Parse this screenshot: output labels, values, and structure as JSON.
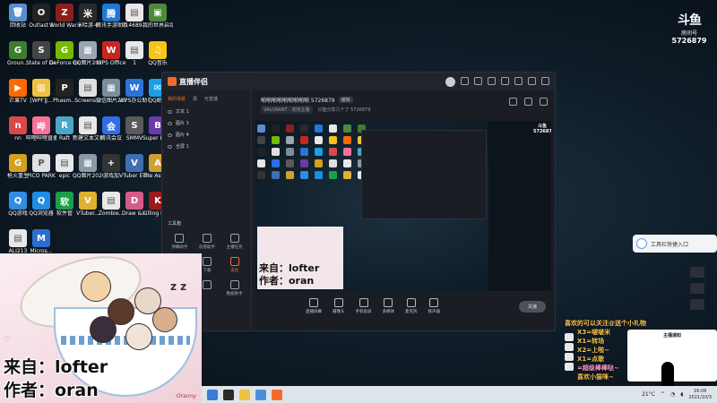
{
  "desktop": {
    "icons": [
      {
        "label": "回收站",
        "color": "#5b8ccf",
        "glyph": "🗑"
      },
      {
        "label": "Outlast 2",
        "color": "#222222",
        "glyph": "O"
      },
      {
        "label": "World War Z",
        "color": "#8b1e1e",
        "glyph": "Z"
      },
      {
        "label": "米哈游-6",
        "color": "#2a2a2a",
        "glyph": "米"
      },
      {
        "label": "腾讯手游助手",
        "color": "#1f7ad6",
        "glyph": "腾"
      },
      {
        "label": "914689...",
        "color": "#e8e8e8",
        "glyph": "▤"
      },
      {
        "label": "我的世界启动器",
        "color": "#4c8a3a",
        "glyph": "▣"
      },
      {
        "label": "Groun...",
        "color": "#3d7d2e",
        "glyph": "G"
      },
      {
        "label": "State of Decay 2",
        "color": "#444444",
        "glyph": "S"
      },
      {
        "label": "GeForce Experie...",
        "color": "#76b900",
        "glyph": "G"
      },
      {
        "label": "QQ图片202106...",
        "color": "#9aa7b3",
        "glyph": "▦"
      },
      {
        "label": "WPS Office",
        "color": "#c8261f",
        "glyph": "W"
      },
      {
        "label": "1",
        "color": "#e8e8e8",
        "glyph": "▤"
      },
      {
        "label": "QQ音乐",
        "color": "#f5c518",
        "glyph": "♫"
      },
      {
        "label": "芒果TV",
        "color": "#ff6a00",
        "glyph": "▶"
      },
      {
        "label": "[WPF]J...",
        "color": "#f0c140",
        "glyph": "▥"
      },
      {
        "label": "Phasm...",
        "color": "#222222",
        "glyph": "P"
      },
      {
        "label": "Screens...",
        "color": "#e0e0e0",
        "glyph": "▤"
      },
      {
        "label": "微信图片202106...",
        "color": "#7b8e9c",
        "glyph": "▦"
      },
      {
        "label": "WPS办公助手",
        "color": "#2b73d6",
        "glyph": "W"
      },
      {
        "label": "QQ邮箱",
        "color": "#1aa0e8",
        "glyph": "✉"
      },
      {
        "label": "nn",
        "color": "#d84a4a",
        "glyph": "n"
      },
      {
        "label": "哔哩哔哩直播姬",
        "color": "#fb7299",
        "glyph": "哔"
      },
      {
        "label": "Raft",
        "color": "#4aa7c8",
        "glyph": "R"
      },
      {
        "label": "新建文本文档",
        "color": "#e8e8e8",
        "glyph": "▤"
      },
      {
        "label": "腾讯会议",
        "color": "#2f6ee6",
        "glyph": "会"
      },
      {
        "label": "SMMV",
        "color": "#5a5a5a",
        "glyph": "S"
      },
      {
        "label": "Super Bun...",
        "color": "#6a3ba8",
        "glyph": "B"
      },
      {
        "label": "枪火重生",
        "color": "#d3a11e",
        "glyph": "G"
      },
      {
        "label": "PICO PARK",
        "color": "#e0e0e0",
        "glyph": "P"
      },
      {
        "label": "epic",
        "color": "#e8e8e8",
        "glyph": "▤"
      },
      {
        "label": "QQ图片202007...",
        "color": "#8a9aa8",
        "glyph": "▦"
      },
      {
        "label": "游戏加",
        "color": "#333333",
        "glyph": "+"
      },
      {
        "label": "VTuber Editor",
        "color": "#3f6fb0",
        "glyph": "V"
      },
      {
        "label": "The Ascent",
        "color": "#cfa030",
        "glyph": "A"
      },
      {
        "label": "QQ游戏",
        "color": "#2f8de4",
        "glyph": "Q"
      },
      {
        "label": "QQ浏览器",
        "color": "#1f8ce6",
        "glyph": "Q"
      },
      {
        "label": "软件管",
        "color": "#1aa04a",
        "glyph": "软"
      },
      {
        "label": "VTuber...",
        "color": "#e0b030",
        "glyph": "V"
      },
      {
        "label": "Zombie...",
        "color": "#e8e8e8",
        "glyph": "▤"
      },
      {
        "label": "Draw &...",
        "color": "#d55a8a",
        "glyph": "D"
      },
      {
        "label": "Killing Floor 2",
        "color": "#9b1a1a",
        "glyph": "K"
      },
      {
        "label": "ALI213",
        "color": "#e8e8e8",
        "glyph": "▤"
      },
      {
        "label": "Micros...",
        "color": "#2a6fd0",
        "glyph": "M"
      }
    ]
  },
  "overlay_logo": {
    "mark": "斗鱼",
    "room_label": "房间号",
    "room_number": "5726879"
  },
  "stream_app": {
    "title": "直播伴侣",
    "left_tabs": [
      "我的场景",
      "源",
      "可直播"
    ],
    "scenes": [
      "文本 1",
      "图片 3",
      "图片 4",
      "全屏 1"
    ],
    "tools_label": "工具箱",
    "tools": [
      {
        "label": "弹幕助手",
        "hl": false
      },
      {
        "label": "房管助手",
        "hl": false
      },
      {
        "label": "主播任务",
        "hl": false
      },
      {
        "label": "房间管理",
        "hl": false
      },
      {
        "label": "下载",
        "hl": false
      },
      {
        "label": "道具",
        "hl": true
      },
      {
        "label": "高清推流",
        "hl": false
      },
      {
        "label": "",
        "hl": false
      },
      {
        "label": "数据助手",
        "hl": false
      }
    ],
    "room_title": "啪啪啪啪啪啪啪啪啪 5726879",
    "edit_label": "编辑",
    "category": "VALORANT - 欢快主播",
    "room_meta": "只能分享几个了 5726879",
    "controls": [
      "直播屏幕",
      "摄像头",
      "手机投屏",
      "多媒体",
      "麦克风",
      "扬声器"
    ],
    "go_live": "关播"
  },
  "fanart": {
    "source_line": "来自：lofter",
    "author_line": "作者：oran",
    "signature": "Oranny"
  },
  "side_widget": {
    "label": "工具栏快捷入口"
  },
  "chat": {
    "title": "喜欢的可以关注@送个小礼物",
    "lines": [
      {
        "text": "X3=啵啵米",
        "pink": false
      },
      {
        "text": "X1=转场",
        "pink": false
      },
      {
        "text": "X2=上啦~",
        "pink": false
      },
      {
        "text": "X1=点歌",
        "pink": false
      },
      {
        "text": "=超级棒棒哒~",
        "pink": true
      },
      {
        "text": "喜欢小猫咪~",
        "pink": false
      }
    ],
    "card_title": "主播通知"
  },
  "taskbar": {
    "temperature": "21°C",
    "time": "16:06",
    "date": "2021/10/3"
  }
}
